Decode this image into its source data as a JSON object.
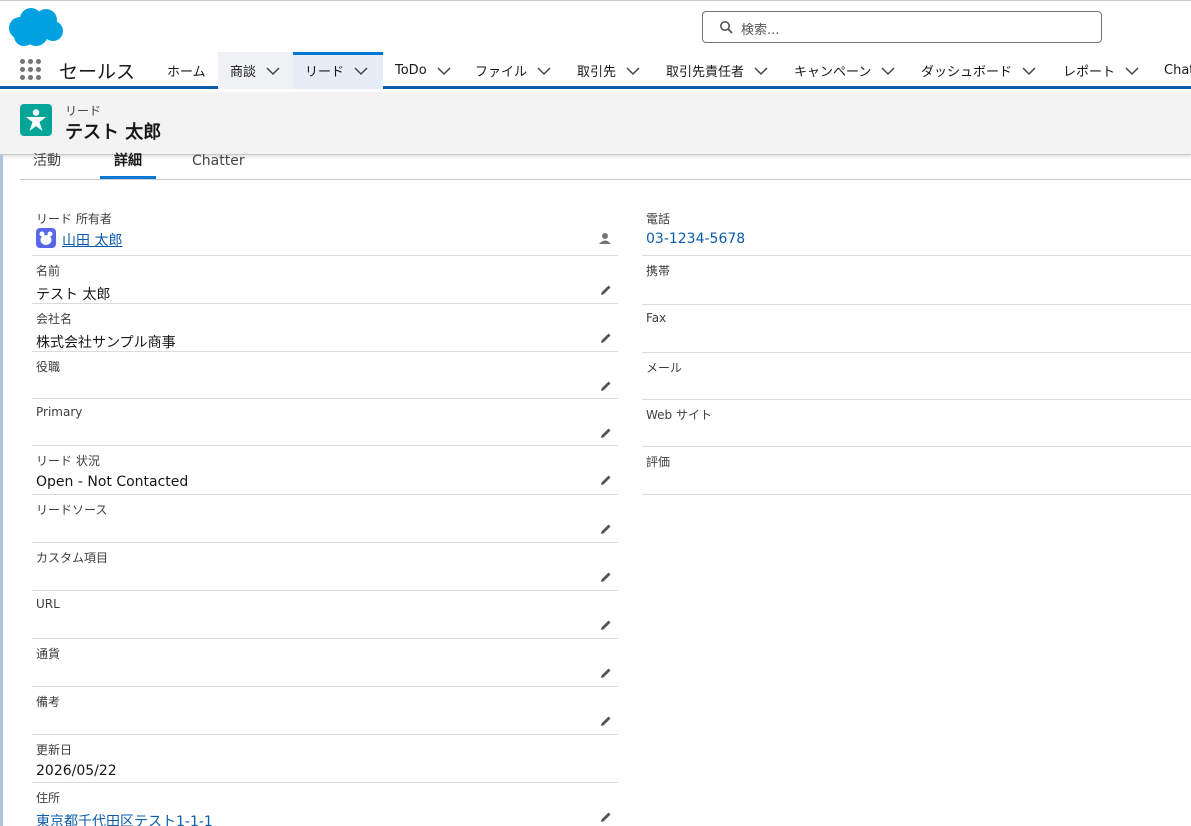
{
  "brand": {
    "logo_icon": "salesforce-cloud-logo",
    "accent": "#0176d3",
    "nav_border": "#0b5cab"
  },
  "search": {
    "placeholder": "検索..."
  },
  "app": {
    "name": "セールス"
  },
  "nav": {
    "items": [
      {
        "label": "ホーム",
        "dropdown": false
      },
      {
        "label": "商談",
        "dropdown": true
      },
      {
        "label": "リード",
        "dropdown": true,
        "active": true
      },
      {
        "label": "ToDo",
        "dropdown": true
      },
      {
        "label": "ファイル",
        "dropdown": true
      },
      {
        "label": "取引先",
        "dropdown": true
      },
      {
        "label": "取引先責任者",
        "dropdown": true
      },
      {
        "label": "キャンペーン",
        "dropdown": true
      },
      {
        "label": "ダッシュボード",
        "dropdown": true
      },
      {
        "label": "レポート",
        "dropdown": true
      },
      {
        "label": "Chat",
        "dropdown": false
      }
    ]
  },
  "record": {
    "object_label": "リード",
    "title": "テスト 太郎",
    "icon": "lead-icon",
    "icon_color": "#06a59a"
  },
  "tabs": [
    "活動",
    "詳細",
    "Chatter"
  ],
  "fields_left": [
    {
      "label": "リード 所有者",
      "value": "山田 太郎",
      "type": "owner"
    },
    {
      "label": "名前",
      "value": "テスト 太郎",
      "type": "text"
    },
    {
      "label": "会社名",
      "value": "株式会社サンプル商事",
      "type": "text"
    },
    {
      "label": "役職",
      "value": "",
      "type": "text"
    },
    {
      "label": "Primary",
      "value": "",
      "type": "text"
    },
    {
      "label": "リード 状況",
      "value": "Open - Not Contacted",
      "type": "text"
    },
    {
      "label": "リードソース",
      "value": "",
      "type": "text"
    },
    {
      "label": "カスタム項目",
      "value": "",
      "type": "text"
    },
    {
      "label": "URL",
      "value": "",
      "type": "text"
    },
    {
      "label": "通貨",
      "value": "",
      "type": "text"
    },
    {
      "label": "備考",
      "value": "",
      "type": "text"
    },
    {
      "label": "更新日",
      "value": "2026/05/22",
      "type": "readonly"
    },
    {
      "label": "住所",
      "value": "東京都千代田区テスト1-1-1",
      "type": "link"
    }
  ],
  "fields_right": [
    {
      "label": "電話",
      "value": "03-1234-5678",
      "type": "link"
    },
    {
      "label": "携帯",
      "value": ""
    },
    {
      "label": "Fax",
      "value": ""
    },
    {
      "label": "メール",
      "value": ""
    },
    {
      "label": "Web サイト",
      "value": ""
    },
    {
      "label": "評価",
      "value": ""
    }
  ]
}
